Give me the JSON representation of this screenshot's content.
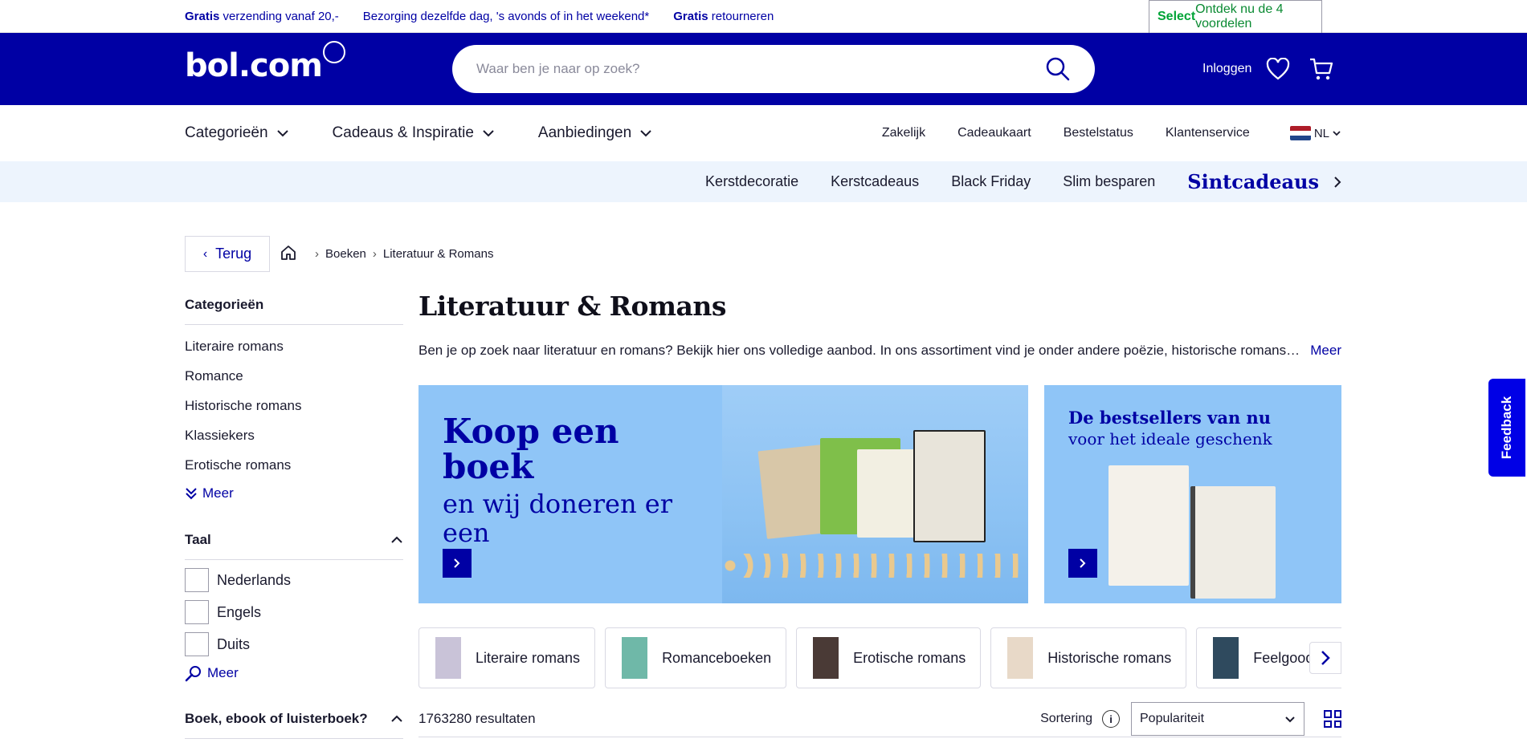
{
  "topbar": {
    "usp1_bold": "Gratis",
    "usp1_rest": "verzending vanaf 20,-",
    "usp2": "Bezorging dezelfde dag, 's avonds of in het weekend*",
    "usp3_bold": "Gratis",
    "usp3_rest": "retourneren",
    "select_bold": "Select",
    "select_rest": "Ontdek nu de 4 voordelen"
  },
  "header": {
    "logo": "bol.com",
    "search_placeholder": "Waar ben je naar op zoek?",
    "login": "Inloggen"
  },
  "nav": {
    "dropdowns": [
      "Categorieën",
      "Cadeaus & Inspiratie",
      "Aanbiedingen"
    ],
    "links": [
      "Zakelijk",
      "Cadeaukaart",
      "Bestelstatus",
      "Klantenservice"
    ],
    "lang": "NL"
  },
  "subnav": {
    "items": [
      "Kerstdecoratie",
      "Kerstcadeaus",
      "Black Friday",
      "Slim besparen"
    ],
    "promo": "Sintcadeaus"
  },
  "breadcrumb": {
    "back": "Terug",
    "items": [
      "Boeken",
      "Literatuur & Romans"
    ]
  },
  "sidebar": {
    "categories_title": "Categorieën",
    "categories": [
      "Literaire romans",
      "Romance",
      "Historische romans",
      "Klassiekers",
      "Erotische romans"
    ],
    "more": "Meer",
    "language_title": "Taal",
    "languages": [
      "Nederlands",
      "Engels",
      "Duits"
    ],
    "format_title": "Boek, ebook of luisterboek?"
  },
  "main": {
    "title": "Literatuur & Romans",
    "intro": "Ben je op zoek naar literatuur en romans? Bekijk hier ons volledige aanbod. In ons assortiment vind je onder andere poëzie, historische romans en nog veel meer.",
    "intro_more": "Meer",
    "banner1_title": "Koop een boek",
    "banner1_sub": "en wij doneren er een",
    "banner2_title": "De bestsellers van nu",
    "banner2_sub": "voor het ideale geschenk",
    "chips": [
      "Literaire romans",
      "Romanceboeken",
      "Erotische romans",
      "Historische romans",
      "Feelgoodromans"
    ],
    "results": "1763280 resultaten",
    "sort_label": "Sortering",
    "sort_value": "Populariteit"
  },
  "feedback": "Feedback",
  "colors": {
    "brand": "#0000a4",
    "select_green": "#00a437",
    "banner": "#8fc5f7"
  }
}
